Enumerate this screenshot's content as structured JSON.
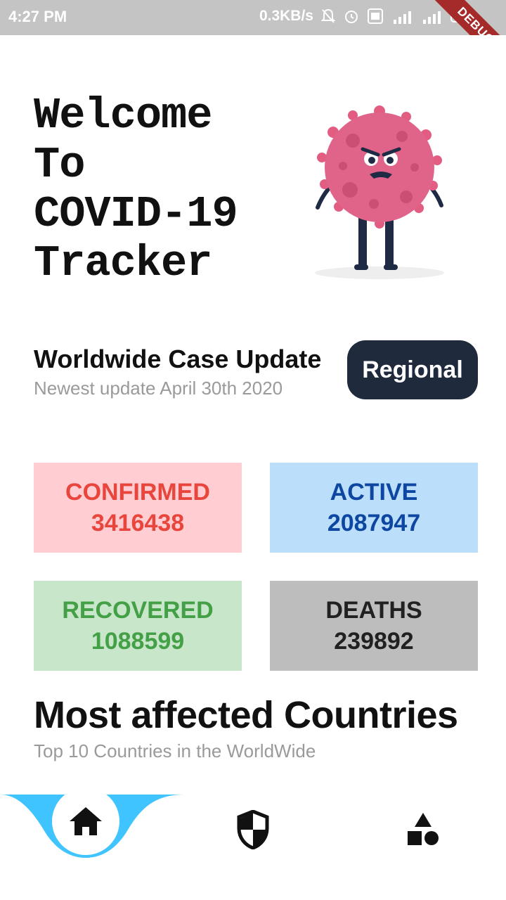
{
  "status_bar": {
    "time": "4:27 PM",
    "net_speed": "0.3KB/s",
    "icons": [
      "bell-off-icon",
      "alarm-icon",
      "volte-icon",
      "signal-4g-icon",
      "signal-icon",
      "battery-charging-icon"
    ],
    "debug_banner": "DEBUG"
  },
  "welcome": {
    "title": "Welcome\nTo\nCOVID-19\nTracker",
    "illustration": "virus-character-illustration"
  },
  "case_update": {
    "title": "Worldwide Case Update",
    "subtitle": "Newest update April 30th 2020",
    "regional_button": "Regional"
  },
  "stats": {
    "confirmed": {
      "label": "CONFIRMED",
      "value": "3416438"
    },
    "active": {
      "label": "ACTIVE",
      "value": "2087947"
    },
    "recovered": {
      "label": "RECOVERED",
      "value": "1088599"
    },
    "deaths": {
      "label": "DEATHS",
      "value": "239892"
    }
  },
  "most_affected": {
    "title": "Most affected Countries",
    "subtitle": "Top 10 Countries in the WorldWide"
  },
  "bottom_nav": {
    "items": [
      "home-icon",
      "shield-icon",
      "shapes-icon"
    ],
    "selected": "home-icon"
  },
  "colors": {
    "status_bar": "#c4c4c4",
    "accent": "#40c4ff",
    "regional_button": "#1f2a3c",
    "confirmed_bg": "#ffcdd2",
    "confirmed_text": "#e8453c",
    "active_bg": "#bbdefb",
    "active_text": "#0d47a1",
    "recovered_bg": "#c8e6c9",
    "recovered_text": "#43a047",
    "deaths_bg": "#bdbdbd",
    "deaths_text": "#212121"
  }
}
